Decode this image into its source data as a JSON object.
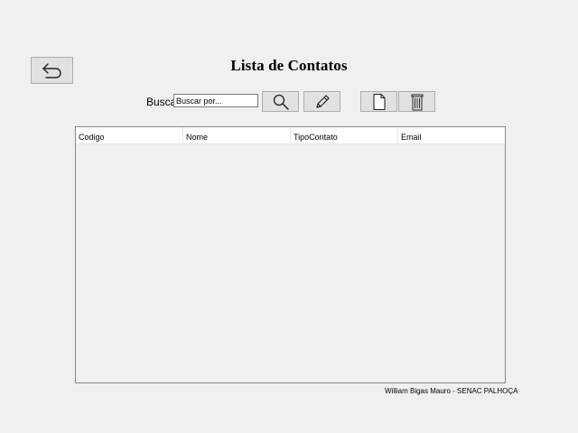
{
  "window": {
    "title": "Lista de Contatos"
  },
  "toolbar": {
    "back_icon": "back-arrow-icon",
    "search_label": "Busca",
    "search_placeholder": "Buscar por...",
    "search_value": "",
    "search_icon": "magnifier-icon",
    "edit_icon": "pencil-icon",
    "new_icon": "new-document-icon",
    "delete_icon": "trash-icon"
  },
  "table": {
    "columns": [
      "Codigo",
      "Nome",
      "TipoContato",
      "Email"
    ],
    "rows": []
  },
  "footer": {
    "credit": "William Bigas Mauro - SENAC PALHOÇA"
  }
}
